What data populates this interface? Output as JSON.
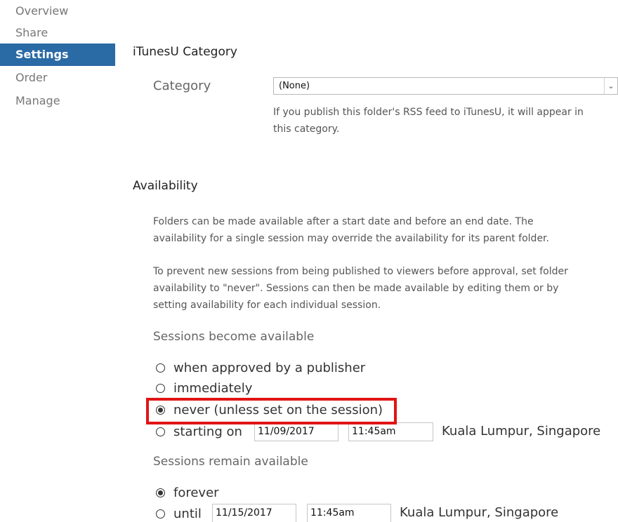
{
  "sidebar": {
    "items": [
      {
        "label": "Overview"
      },
      {
        "label": "Share"
      },
      {
        "label": "Settings",
        "active": true
      },
      {
        "label": "Order"
      },
      {
        "label": "Manage"
      }
    ]
  },
  "itunesu": {
    "title": "iTunesU Category",
    "category_label": "Category",
    "category_value": "(None)",
    "help_line1": "If you publish this folder's RSS feed to iTunesU, it will appear in",
    "help_line2": "this category."
  },
  "availability": {
    "title": "Availability",
    "para1_line1": "Folders can be made available after a start date and before an end date. The",
    "para1_line2": "availability for a single session may override the availability for its parent folder.",
    "para2_line1": "To prevent new sessions from being published to viewers before approval, set folder",
    "para2_line2": "availability to \"never\". Sessions can then be made available by editing them or by",
    "para2_line3": "setting availability for each individual session.",
    "become_label": "Sessions become available",
    "become_options": [
      {
        "label": "when approved by a publisher",
        "checked": false
      },
      {
        "label": "immediately",
        "checked": false
      },
      {
        "label": "never (unless set on the session)",
        "checked": true
      },
      {
        "label": "starting on",
        "checked": false
      }
    ],
    "start_date": "11/09/2017",
    "start_time": "11:45am",
    "start_timezone": "Kuala Lumpur, Singapore",
    "remain_label": "Sessions remain available",
    "remain_options": [
      {
        "label": "forever",
        "checked": true
      },
      {
        "label": "until",
        "checked": false
      }
    ],
    "end_date": "11/15/2017",
    "end_time": "11:45am",
    "end_timezone": "Kuala Lumpur, Singapore"
  },
  "colors": {
    "active_nav_bg": "#2a6aa5",
    "highlight": "#e01414"
  }
}
